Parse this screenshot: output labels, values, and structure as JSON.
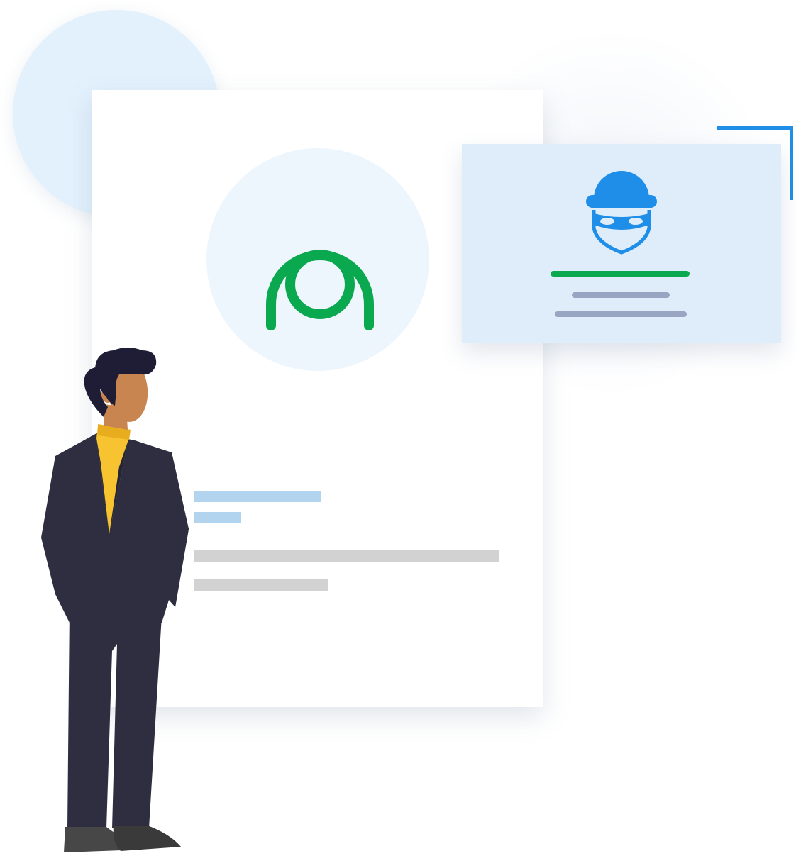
{
  "colors": {
    "accent_blue": "#1f8ee8",
    "accent_green": "#0aa84f",
    "card_bg": "#ffffff",
    "threat_card_bg": "#deedf9",
    "avatar_bg": "#edf5fd",
    "placeholder_blue": "#b3d4ee",
    "placeholder_grey": "#d2d2d2",
    "placeholder_slate": "#98a5c3",
    "suit": "#2e2e40",
    "turtleneck": "#f7c331",
    "skin": "#c9854f",
    "hair": "#1f1d36"
  },
  "icons": {
    "profile": "user-icon",
    "threat": "burglar-icon",
    "figure": "standing-person-illustration"
  }
}
